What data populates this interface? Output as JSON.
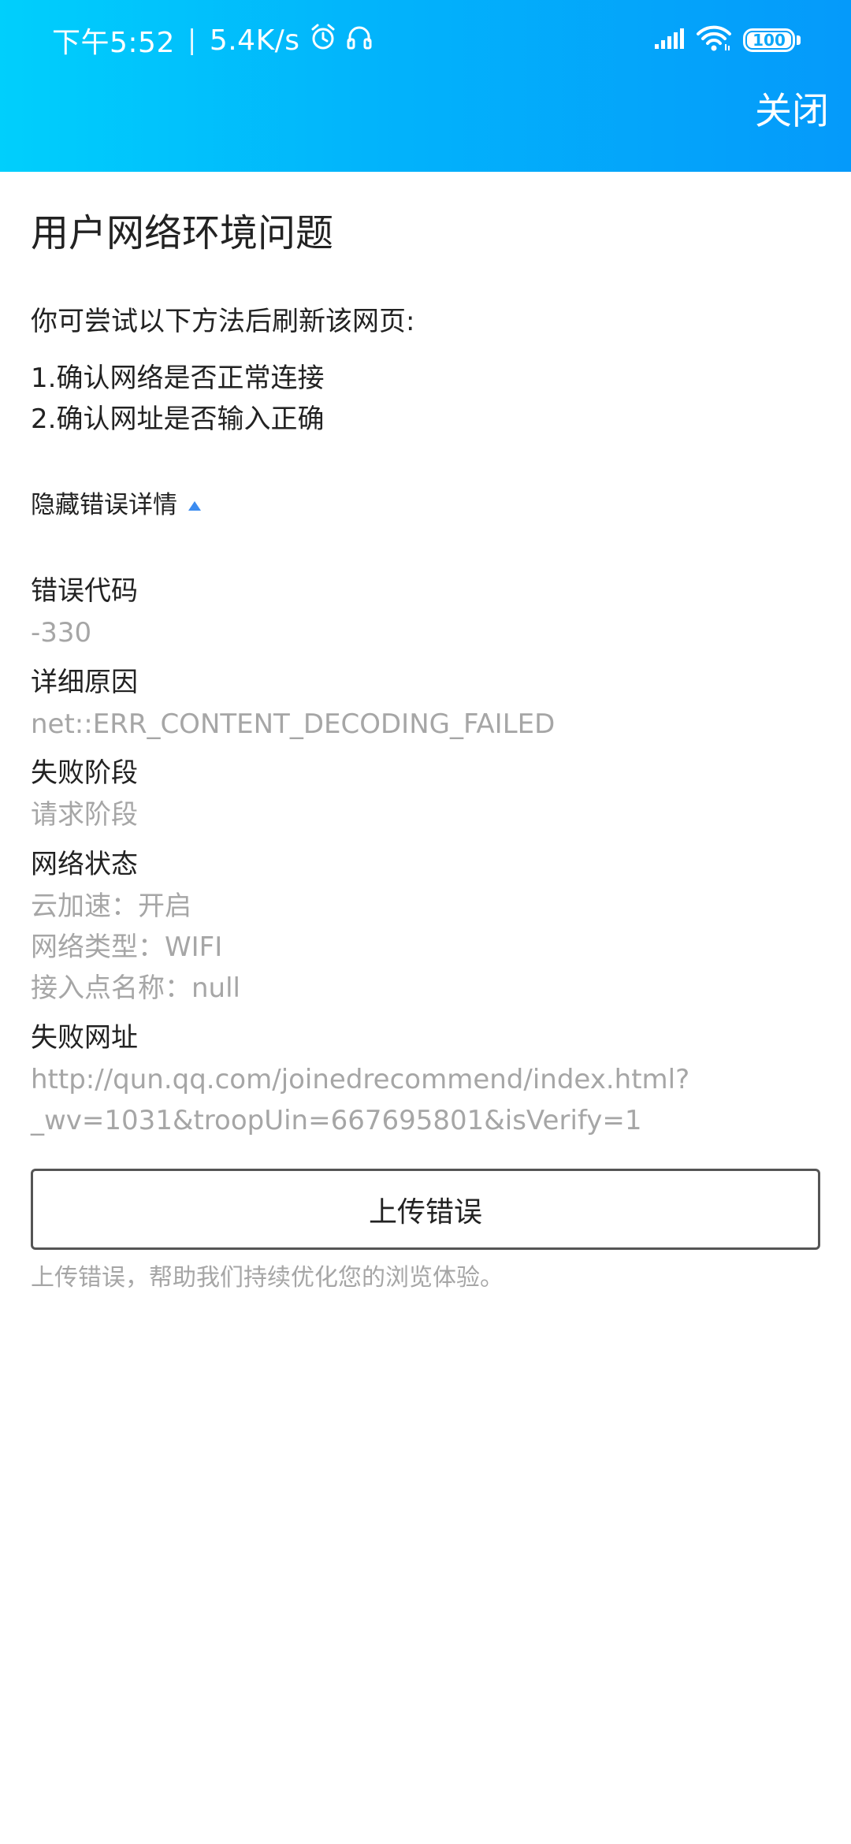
{
  "statusbar": {
    "time": "下午5:52",
    "separator": "|",
    "speed": "5.4K/s",
    "battery": "100"
  },
  "header": {
    "close_label": "关闭"
  },
  "page": {
    "title": "用户网络环境问题",
    "instruction": "你可尝试以下方法后刷新该网页:",
    "steps": [
      "1.确认网络是否正常连接",
      "2.确认网址是否输入正确"
    ],
    "toggle_label": "隐藏错误详情"
  },
  "details": {
    "error_code_label": "错误代码",
    "error_code": "-330",
    "reason_label": "详细原因",
    "reason": "net::ERR_CONTENT_DECODING_FAILED",
    "stage_label": "失败阶段",
    "stage": "请求阶段",
    "network_label": "网络状态",
    "network_lines": [
      "云加速：开启",
      "网络类型：WIFI",
      "接入点名称：null"
    ],
    "url_label": "失败网址",
    "url_lines": [
      "http://qun.qq.com/joinedrecommend/index.html?",
      "_wv=1031&troopUin=667695801&isVerify=1"
    ]
  },
  "upload": {
    "button_label": "上传错误",
    "hint": "上传错误，帮助我们持续优化您的浏览体验。"
  }
}
